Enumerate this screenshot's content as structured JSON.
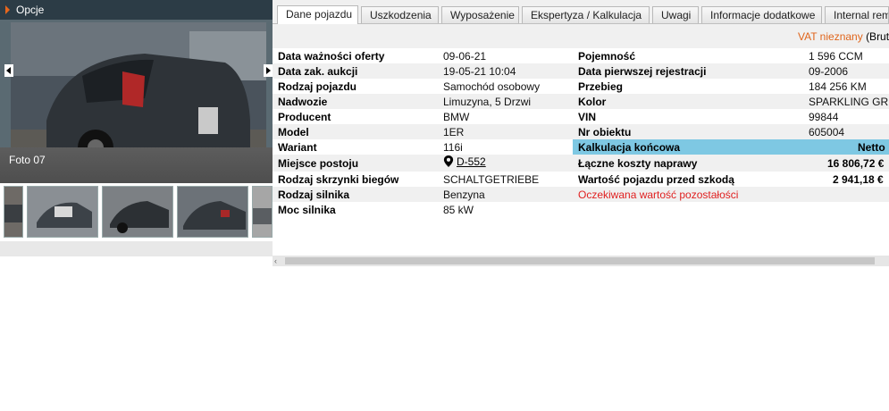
{
  "left_panel": {
    "options_label": "Opcje",
    "photo_caption": "Foto 07"
  },
  "tabs": [
    {
      "label": "Dane pojazdu",
      "active": true
    },
    {
      "label": "Uszkodzenia"
    },
    {
      "label": "Wyposażenie"
    },
    {
      "label": "Ekspertyza / Kalkulacja"
    },
    {
      "label": "Uwagi"
    },
    {
      "label": "Informacje dodatkowe"
    },
    {
      "label": "Internal rem"
    }
  ],
  "vat": {
    "unknown": "VAT nieznany",
    "brut": "(Brut"
  },
  "vehicle": {
    "rows": [
      {
        "label": "Data ważności oferty",
        "value": "09-06-21"
      },
      {
        "label": "Data zak. aukcji",
        "value": "19-05-21 10:04"
      },
      {
        "label": "Rodzaj pojazdu",
        "value": "Samochód osobowy"
      },
      {
        "label": "Nadwozie",
        "value": "Limuzyna, 5 Drzwi"
      },
      {
        "label": "Producent",
        "value": "BMW"
      },
      {
        "label": "Model",
        "value": "1ER"
      },
      {
        "label": "Wariant",
        "value": "116i"
      },
      {
        "label": "Miejsce postoju",
        "value": "D-552"
      },
      {
        "label": "Rodzaj skrzynki biegów",
        "value": "SCHALTGETRIEBE"
      },
      {
        "label": "Rodzaj silnika",
        "value": "Benzyna"
      },
      {
        "label": "Moc silnika",
        "value": "85 kW"
      }
    ]
  },
  "specs": {
    "rows": [
      {
        "label": "Pojemność",
        "value": "1 596 CCM"
      },
      {
        "label": "Data pierwszej rejestracji",
        "value": "09-2006"
      },
      {
        "label": "Przebieg",
        "value": "184 256 KM"
      },
      {
        "label": "Kolor",
        "value": "SPARKLING GR"
      },
      {
        "label": "VIN",
        "value": "99844"
      },
      {
        "label": "Nr obiektu",
        "value": "605004"
      }
    ]
  },
  "calculation": {
    "header": "Kalkulacja końcowa",
    "netto_label": "Netto",
    "repair_label": "Łączne koszty naprawy",
    "repair_value": "16 806,72 €",
    "pre_damage_label": "Wartość pojazdu przed szkodą",
    "pre_damage_value": "2 941,18 €",
    "residual_label": "Oczekiwana wartość pozostałości"
  },
  "colors": {
    "calc_header_bg": "#7ec8e3",
    "vat_orange": "#e0651b",
    "residual_red": "#e02020",
    "options_chevron": "#e8661c"
  }
}
